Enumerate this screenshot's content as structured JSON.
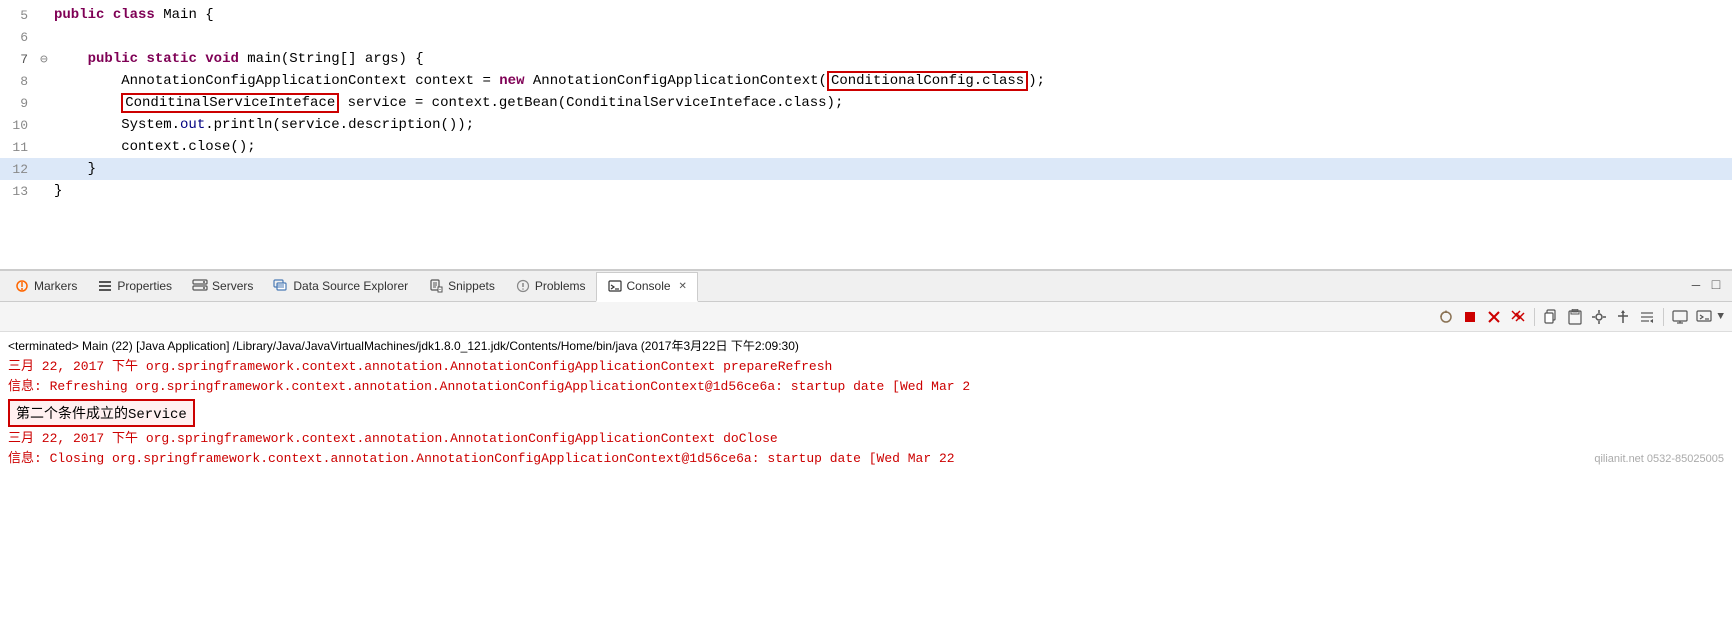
{
  "editor": {
    "lines": [
      {
        "number": "5",
        "marker": "",
        "content": "public class Main {",
        "indent": 0
      },
      {
        "number": "6",
        "marker": "",
        "content": "",
        "indent": 0
      },
      {
        "number": "7",
        "marker": "⊖",
        "content": "    public static void main(String[] args) {",
        "indent": 0
      },
      {
        "number": "8",
        "marker": "",
        "content": "        AnnotationConfigApplicationContext context = new AnnotationConfigApplicationContext(ConditionalConfig.class);",
        "indent": 0,
        "redbox1": "ConditionalConfig.class"
      },
      {
        "number": "9",
        "marker": "",
        "content": "        ConditinalServiceInteface service = context.getBean(ConditinalServiceInteface.class);",
        "indent": 0,
        "redbox2": "ConditinalServiceInteface"
      },
      {
        "number": "10",
        "marker": "",
        "content": "        System.out.println(service.description());",
        "indent": 0
      },
      {
        "number": "11",
        "marker": "",
        "content": "        context.close();",
        "indent": 0
      },
      {
        "number": "12",
        "marker": "",
        "content": "    }",
        "indent": 0,
        "highlighted": true
      },
      {
        "number": "13",
        "marker": "",
        "content": "}",
        "indent": 0
      }
    ]
  },
  "tabs": {
    "items": [
      {
        "id": "markers",
        "label": "Markers",
        "icon": "👁",
        "active": false
      },
      {
        "id": "properties",
        "label": "Properties",
        "icon": "▤",
        "active": false
      },
      {
        "id": "servers",
        "label": "Servers",
        "icon": "🔧",
        "active": false
      },
      {
        "id": "datasource",
        "label": "Data Source Explorer",
        "icon": "🗃",
        "active": false
      },
      {
        "id": "snippets",
        "label": "Snippets",
        "icon": "📄",
        "active": false
      },
      {
        "id": "problems",
        "label": "Problems",
        "icon": "👁",
        "active": false
      },
      {
        "id": "console",
        "label": "Console",
        "icon": "🖥",
        "active": true
      }
    ],
    "close_icon": "✕",
    "minimize_icon": "—",
    "maximize_icon": "□"
  },
  "console": {
    "toolbar_buttons": [
      "🔗",
      "■",
      "✕",
      "✖",
      "📋",
      "📊",
      "📈",
      "📉",
      "📌",
      "⬆",
      "⬇",
      "📎",
      "▼"
    ],
    "header": "<terminated> Main (22) [Java Application] /Library/Java/JavaVirtualMachines/jdk1.8.0_121.jdk/Contents/Home/bin/java (2017年3月22日 下午2:09:30)",
    "lines": [
      {
        "text": "三月 22, 2017 下午 org.springframework.context.annotation.AnnotationConfigApplicationContext prepareRefresh",
        "color": "red"
      },
      {
        "text": "信息: Refreshing org.springframework.context.annotation.AnnotationConfigApplicationContext@1d56ce6a: startup date [Wed Mar 2",
        "color": "red"
      },
      {
        "text": "第二个条件成立的Service",
        "color": "black",
        "highlight": true
      },
      {
        "text": "三月 22, 2017 下午 org.springframework.context.annotation.AnnotationConfigApplicationContext doClose",
        "color": "red"
      },
      {
        "text": "信息: Closing org.springframework.context.annotation.AnnotationConfigApplicationContext@1d56ce6a: startup date [Wed Mar 22",
        "color": "red"
      }
    ],
    "watermark": "qilianit.net 0532-85025005"
  }
}
